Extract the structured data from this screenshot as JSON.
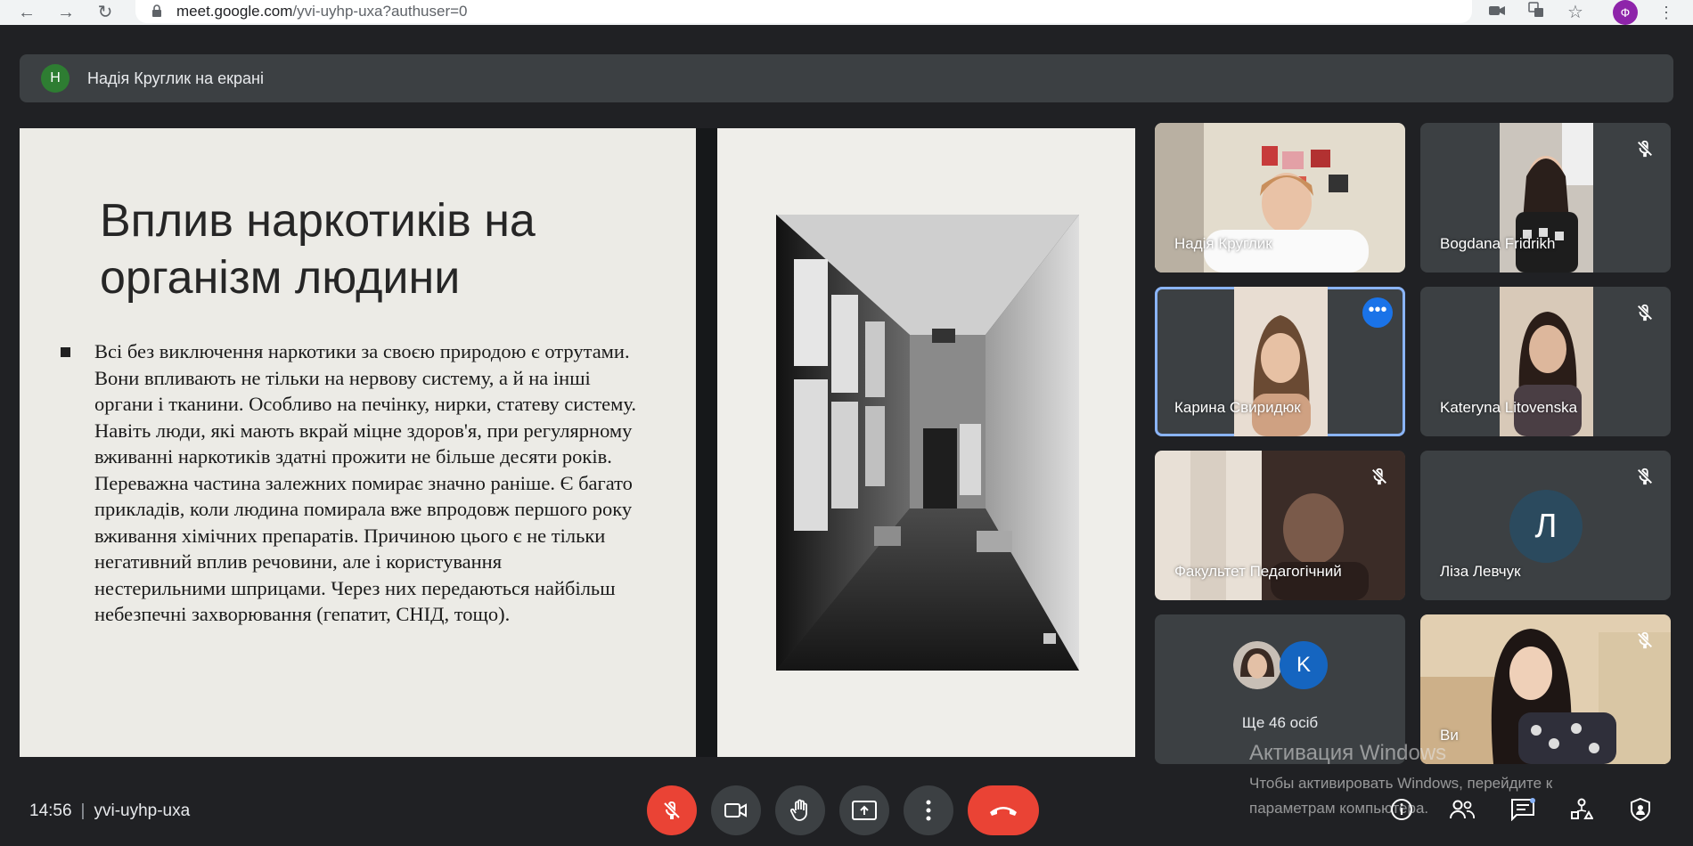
{
  "browser": {
    "url_host": "meet.google.com",
    "url_path": "/yvi-uyhp-uxa?authuser=0",
    "profile_initial": "Ф"
  },
  "banner": {
    "avatar_initial": "Н",
    "text": "Надія Круглик на екрані"
  },
  "slide": {
    "title": "Вплив наркотиків на організм людини",
    "body": "Всі без виключення наркотики за своєю природою є отрутами. Вони впливають не тільки на нервову систему, а й на інші органи і тканини. Особливо на печінку, нирки, статеву систему. Навіть люди, які мають вкрай міцне здоров'я, при регулярному вживанні наркотиків здатні прожити не більше десяти років. Переважна частина залежних помирає значно раніше. Є багато прикладів, коли людина помирала вже впродовж першого року вживання хімічних препаратів. Причиною цього є не тільки негативний вплив речовини, але і користування нестерильними шприцами. Через них передаються найбільш небезпечні захворювання (гепатит, СНІД, тощо)."
  },
  "participants": [
    {
      "name": "Надія Круглик",
      "muted": false
    },
    {
      "name": "Bogdana Fridrikh",
      "muted": true
    },
    {
      "name": "Карина Свиридюк",
      "muted": false
    },
    {
      "name": "Kateryna Litovenska",
      "muted": true
    },
    {
      "name": "Факультет Педагогічний",
      "muted": true
    },
    {
      "name": "Ліза Левчук",
      "muted": true,
      "initial": "Л"
    },
    {
      "name": "Ще 46 осіб",
      "extra_initial": "K"
    },
    {
      "name": "Ви",
      "muted": true
    }
  ],
  "footer": {
    "time": "14:56",
    "separator": "|",
    "meeting_code": "yvi-uyhp-uxa"
  },
  "watermark": {
    "title": "Активация Windows",
    "text": "Чтобы активировать Windows, перейдите к параметрам компьютера."
  },
  "colors": {
    "background": "#202124",
    "tile": "#3c4043",
    "end_call": "#ea4335",
    "accent": "#1a73e8",
    "selected_outline": "#8ab4f8"
  }
}
